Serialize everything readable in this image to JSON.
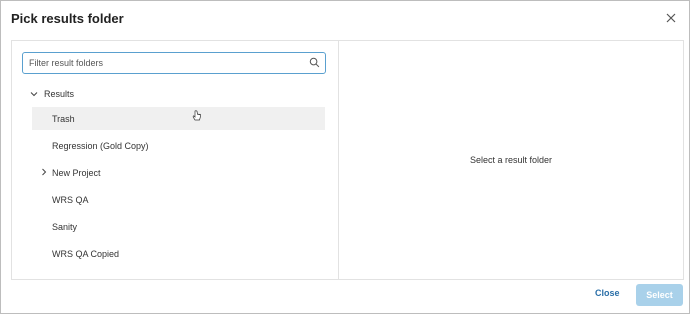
{
  "dialog": {
    "title": "Pick results folder",
    "close_icon": "close-icon"
  },
  "filter": {
    "placeholder": "Filter result folders",
    "value": "",
    "icon": "search-icon"
  },
  "tree": {
    "root": {
      "label": "Results",
      "expanded": true
    },
    "items": [
      {
        "label": "Trash",
        "has_children": false,
        "hover": true
      },
      {
        "label": "Regression (Gold Copy)",
        "has_children": false
      },
      {
        "label": "New Project",
        "has_children": true,
        "expanded": false
      },
      {
        "label": "WRS QA",
        "has_children": false
      },
      {
        "label": "Sanity",
        "has_children": false
      },
      {
        "label": "WRS QA Copied",
        "has_children": false
      }
    ]
  },
  "detail": {
    "empty_text": "Select a result folder"
  },
  "footer": {
    "close_label": "Close",
    "select_label": "Select",
    "select_enabled": false
  },
  "colors": {
    "accent": "#2a6fa8",
    "focus_border": "#5aa0cf",
    "disabled_button": "#a9d1ea",
    "hover_row": "#f0f0f0"
  }
}
